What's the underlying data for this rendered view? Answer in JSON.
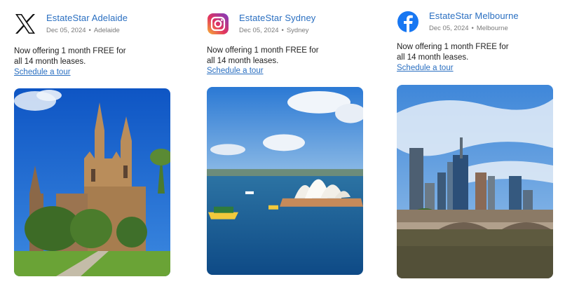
{
  "posts": [
    {
      "platform": "x",
      "platform_icon": "x-logo-icon",
      "account": "EstateStar Adelaide",
      "date": "Dec 05, 2024",
      "location": "Adelaide",
      "text_line1": "Now offering 1 month FREE for",
      "text_line2": "all 14 month leases.",
      "link": "Schedule a tour"
    },
    {
      "platform": "instagram",
      "platform_icon": "instagram-logo-icon",
      "account": "EstateStar Sydney",
      "date": "Dec 05, 2024",
      "location": "Sydney",
      "text_line1": "Now offering 1 month FREE for",
      "text_line2": "all 14 month leases.",
      "link": "Schedule a tour"
    },
    {
      "platform": "facebook",
      "platform_icon": "facebook-logo-icon",
      "account": "EstateStar Melbourne",
      "date": "Dec 05, 2024",
      "location": "Melbourne",
      "text_line1": "Now offering 1 month FREE for",
      "text_line2": "all 14 month leases.",
      "link": "Schedule a tour"
    }
  ],
  "separator": "•",
  "colors": {
    "link": "#2a6fc1",
    "facebook": "#1877f2",
    "x": "#111111"
  }
}
